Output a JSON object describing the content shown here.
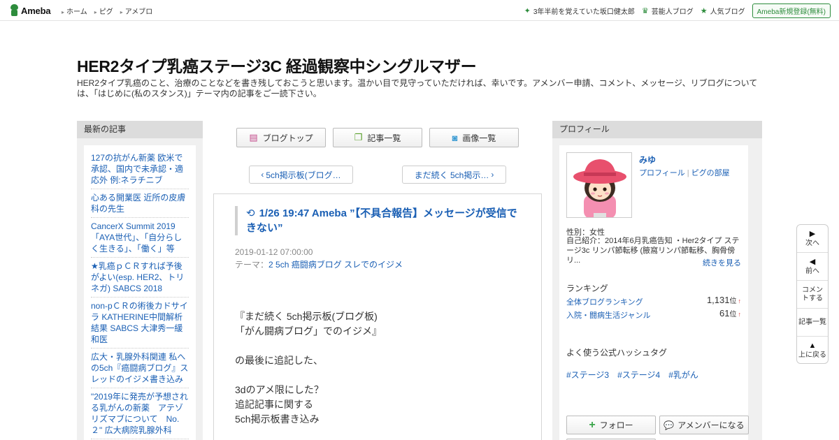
{
  "topbar": {
    "logo": "Ameba",
    "nav": [
      "ホーム",
      "ピグ",
      "アメブロ"
    ],
    "right_links": [
      {
        "icon": "sparkle-icon",
        "glyph": "✦",
        "label": "3年半前を覚えていた坂口健太郎"
      },
      {
        "icon": "crown-icon",
        "glyph": "♛",
        "label": "芸能人ブログ"
      },
      {
        "icon": "star-icon",
        "glyph": "★",
        "label": "人気ブログ"
      }
    ],
    "signup": "Ameba新規登録(無料)"
  },
  "blog": {
    "title": "HER2タイプ乳癌ステージ3C 経過観察中シングルマザー",
    "description": "HER2タイプ乳癌のこと、治療のことなどを書き残しておこうと思います。温かい目で見守っていただければ、幸いです。アメンバー申請、コメント、メッセージ、リブログについては、「はじめに(私のスタンス)」テーマ内の記事をご一読下さい。"
  },
  "left": {
    "heading": "最新の記事",
    "items": [
      "127の抗がん新薬 欧米で承認、国内で未承認・適応外 例:ネラチニブ",
      "心ある開業医 近所の皮膚科の先生",
      "CancerX Summit 2019 「AYA世代」、「自分らしく生きる」、「働く」等",
      "★乳癌ｐＣＲすれば予後がよい(esp. HER2、トリネガ) SABCS 2018",
      "non-pＣＲの術後カドサイラ KATHERINE中間解析結果 SABCS 大津秀一緩和医",
      "広大・乳腺外科関連 私への5ch『癌闘病ブログ』スレッドのイジメ書き込み",
      "\"2019年に発売が予想される乳がんの新薬　アテゾリズマブについて　No.２\" 広大病院乳腺外科"
    ]
  },
  "center": {
    "buttons": {
      "blog_top": "ブログトップ",
      "entry_list": "記事一覧",
      "image_list": "画像一覧"
    },
    "pager": {
      "prev": "5ch掲示板(ブログ…",
      "next": "まだ続く 5ch掲示…"
    },
    "entry": {
      "title": "1/26 19:47 Ameba ”【不具合報告】メッセージが受信できない”",
      "date": "2019-01-12 07:00:00",
      "theme_label": "テーマ：",
      "theme": "2 5ch 癌闘病ブログ スレでのイジメ",
      "body": [
        "『まだ続く 5ch掲示板(ブログ板)",
        "「がん闘病ブログ」でのイジメ』",
        "",
        "の最後に追記した、",
        "",
        "3dのアメ限にした？",
        "追記記事に関する",
        "5ch掲示板書き込み"
      ]
    }
  },
  "right": {
    "heading": "プロフィール",
    "name": "みゆ",
    "profile_link": "プロフィール",
    "pig_link": "ピグの部屋",
    "gender": "性別：女性",
    "intro": "自己紹介：2014年6月乳癌告知 ・Her2タイプ ステージ3c リンパ節転移 (腋窩リンパ節転移、胸骨傍リ...",
    "more": "続きを見る",
    "ranking_title": "ランキング",
    "rankings": [
      {
        "label": "全体ブログランキング",
        "value": "1,131",
        "unit": "位",
        "arrow": "↑"
      },
      {
        "label": "入院・闘病生活ジャンル",
        "value": "61",
        "unit": "位",
        "arrow": "↑"
      }
    ],
    "hashtag_title": "よく使う公式ハッシュタグ",
    "hashtags": [
      "#ステージ3",
      "#ステージ4",
      "#乳がん"
    ],
    "follow": "フォロー",
    "amember": "アメンバーになる"
  },
  "sidenav": {
    "next": "次へ",
    "prev": "前へ",
    "comment": "コメントする",
    "entries": "記事一覧",
    "top": "上に戻る"
  },
  "colors": {
    "accent_green": "#2d8c3c",
    "link_blue": "#1a5fb4"
  }
}
